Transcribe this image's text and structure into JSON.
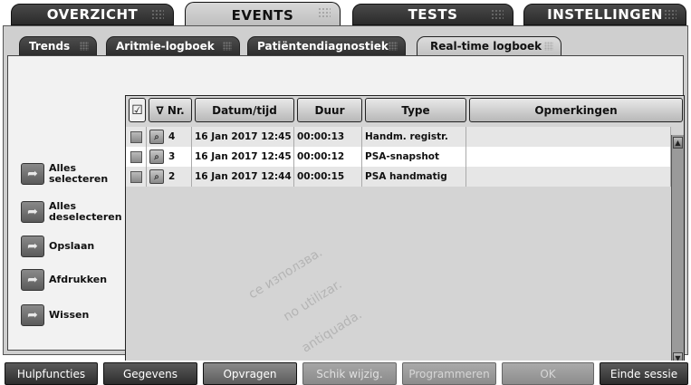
{
  "top_tabs": [
    {
      "label": "OVERZICHT"
    },
    {
      "label": "EVENTS"
    },
    {
      "label": "TESTS"
    },
    {
      "label": "INSTELLINGEN"
    }
  ],
  "sub_tabs": [
    {
      "label": "Trends"
    },
    {
      "label": "Aritmie-logboek"
    },
    {
      "label": "Patiëntendiagnostiek"
    },
    {
      "label": "Real-time logboek"
    }
  ],
  "side_actions": [
    {
      "label": "Alles\nselecteren"
    },
    {
      "label": "Alles\ndeselecteren"
    },
    {
      "label": "Opslaan"
    },
    {
      "label": "Afdrukken"
    },
    {
      "label": "Wissen"
    }
  ],
  "table": {
    "headers": {
      "select": "☑",
      "nr": "∇ Nr.",
      "datetime": "Datum/tijd",
      "duration": "Duur",
      "type": "Type",
      "remarks": "Opmerkingen"
    },
    "rows": [
      {
        "nr": "4",
        "datetime": "16 Jan 2017 12:45",
        "duration": "00:00:13",
        "type": "Handm. registr.",
        "remarks": ""
      },
      {
        "nr": "3",
        "datetime": "16 Jan 2017 12:45",
        "duration": "00:00:12",
        "type": "PSA-snapshot",
        "remarks": ""
      },
      {
        "nr": "2",
        "datetime": "16 Jan 2017 12:44",
        "duration": "00:00:15",
        "type": "PSA handmatig",
        "remarks": ""
      }
    ]
  },
  "bottom_buttons": [
    {
      "label": "Hulpfuncties"
    },
    {
      "label": "Gegevens"
    },
    {
      "label": "Opvragen"
    },
    {
      "label": "Schik wijzig."
    },
    {
      "label": "Programmeren"
    },
    {
      "label": "OK"
    },
    {
      "label": "Einde sessie"
    }
  ],
  "watermark": [
    "ce използва.",
    "no utilizar.",
    "antiquada."
  ]
}
